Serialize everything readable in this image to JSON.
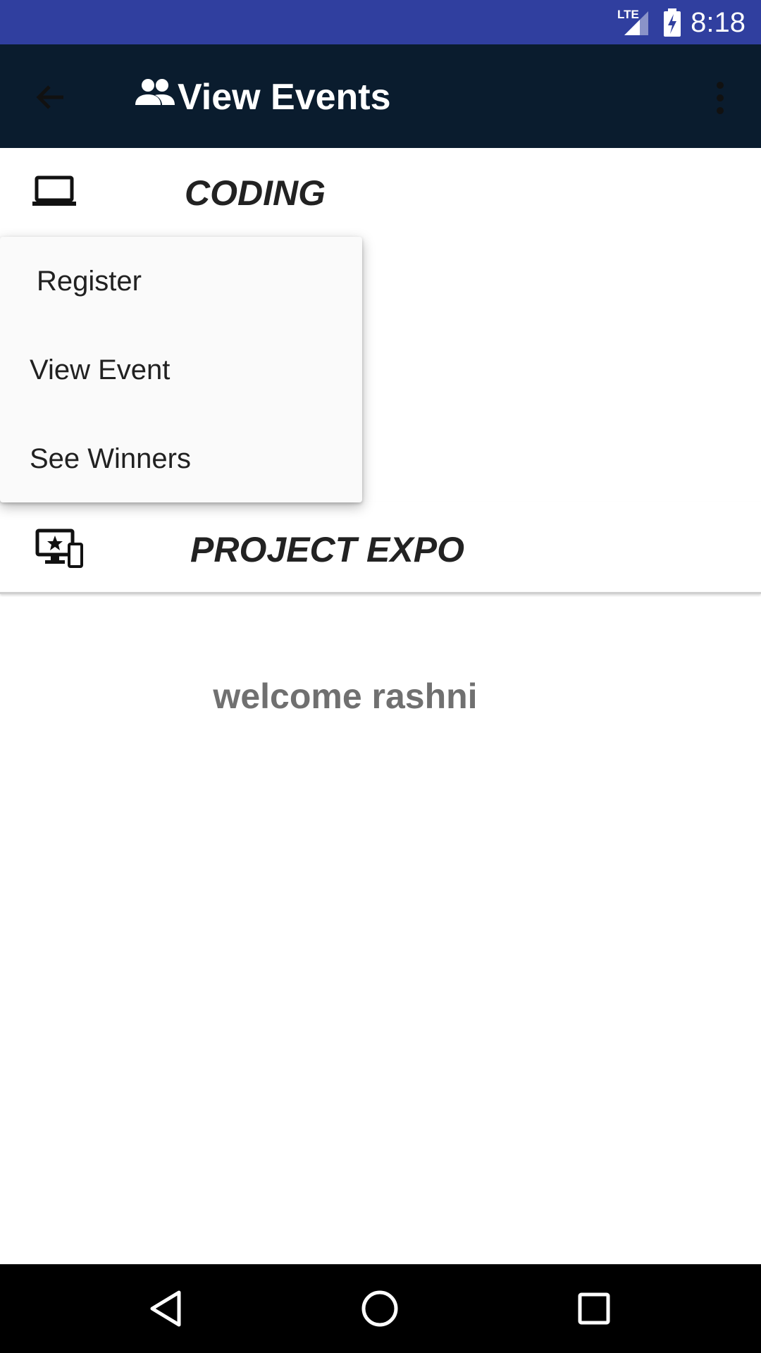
{
  "status_bar": {
    "time": "8:18",
    "network": "LTE",
    "color": "#303f9f"
  },
  "app_bar": {
    "title": "View Events",
    "title_icon": "people-icon",
    "back_icon": "arrow-back-icon",
    "overflow_icon": "more-vert-icon",
    "color": "#0a1c2e"
  },
  "events": [
    {
      "label": "CODING",
      "icon": "laptop-icon"
    },
    {
      "label": "PROJECT EXPO",
      "icon": "devices-star-icon"
    }
  ],
  "popup_menu": {
    "items": [
      {
        "label": "Register"
      },
      {
        "label": "View Event"
      },
      {
        "label": "See Winners"
      }
    ]
  },
  "welcome_text": "welcome rashni",
  "nav_bar": {
    "buttons": [
      "back-triangle-icon",
      "home-circle-icon",
      "recents-square-icon"
    ]
  }
}
